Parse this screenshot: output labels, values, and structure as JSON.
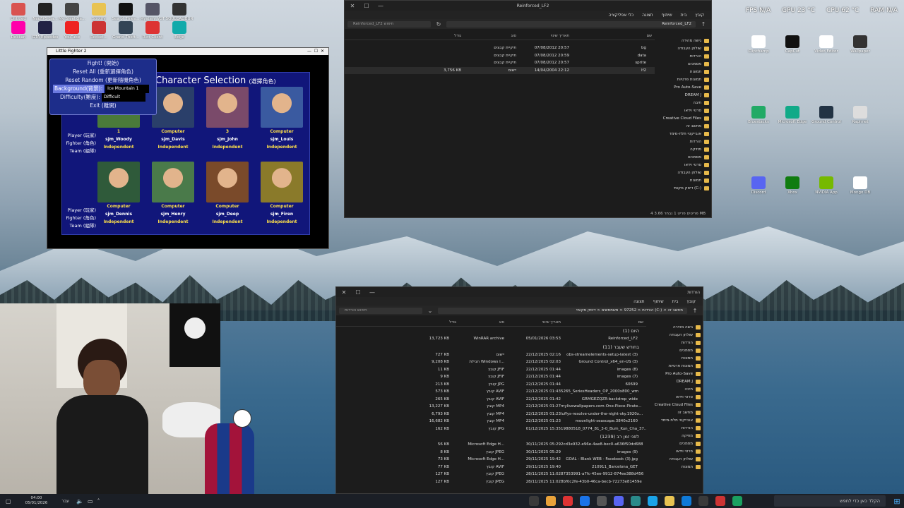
{
  "desktop_left_icons": [
    {
      "label": "Untitled",
      "color": "#d9534f"
    },
    {
      "label": "NeoFPS Ga...",
      "color": "#222"
    },
    {
      "label": "My Steel Ga...",
      "color": "#444"
    },
    {
      "label": "Spotify",
      "color": "#e8c352"
    },
    {
      "label": "Sea of Thiev...",
      "color": "#111"
    },
    {
      "label": "Mystery VGT",
      "color": "#556"
    },
    {
      "label": "SOULCALIBUR",
      "color": "#333"
    },
    {
      "label": "Dokkan",
      "color": "#f0a"
    },
    {
      "label": "GTA Episodes",
      "color": "#224"
    },
    {
      "label": "YouTube",
      "color": "#e22"
    },
    {
      "label": "Rocket...",
      "color": "#c33"
    },
    {
      "label": "Grand Theft...",
      "color": "#345"
    },
    {
      "label": "Riot Client",
      "color": "#d33"
    },
    {
      "label": "Edge",
      "color": "#1aa"
    }
  ],
  "desktop_right_icons": [
    {
      "label": "Clipchamp",
      "color": "#fff"
    },
    {
      "label": "CapCut",
      "color": "#111"
    },
    {
      "label": "Video Editor",
      "color": "#fff"
    },
    {
      "label": "Wallpaper",
      "color": "#333"
    },
    {
      "label": "Bluestacks",
      "color": "#2a6"
    },
    {
      "label": "Microsoft Edge",
      "color": "#1a8"
    },
    {
      "label": "Ground Control",
      "color": "#234"
    },
    {
      "label": "Raphnet",
      "color": "#ddd"
    },
    {
      "label": "Discord",
      "color": "#5865f2"
    },
    {
      "label": "Xbox",
      "color": "#107c10"
    },
    {
      "label": "NVIDIA App",
      "color": "#76b900"
    },
    {
      "label": "Mongo DB",
      "color": "#fff"
    }
  ],
  "lf2": {
    "title": "Little Fighter 2",
    "panel_title": "Character Selection",
    "panel_title_zh": "(選擇角色)",
    "menu": {
      "fight": "Fight! (開始)",
      "reset_all": "Reset All (重新選擇角色)",
      "reset_random": "Reset Random (更新隨機角色)",
      "background_label": "Background(背景):",
      "background_value": "Ice Mountain 1",
      "difficulty_label": "Difficulty(難度):",
      "difficulty_value": "Difficult",
      "exit": "Exit (離開)"
    },
    "row_labels": {
      "player": "Player (玩家)",
      "fighter": "Fighter (角色)",
      "team": "Team (組隊)"
    },
    "top_cards": [
      {
        "player": "1",
        "fighter": "sjm_Woody",
        "team": "Independent",
        "color": "#4a7a3a"
      },
      {
        "player": "Computer",
        "fighter": "sjm_Davis",
        "team": "Independent",
        "color": "#2a3f6a"
      },
      {
        "player": "3",
        "fighter": "sjm_John",
        "team": "Independent",
        "color": "#7a4a6a"
      },
      {
        "player": "Computer",
        "fighter": "sjm_Louis",
        "team": "Independent",
        "color": "#3a5aa0"
      }
    ],
    "bottom_cards": [
      {
        "player": "Computer",
        "fighter": "sjm_Dennis",
        "team": "Independent",
        "color": "#2f5a3a"
      },
      {
        "player": "Computer",
        "fighter": "sjm_Henry",
        "team": "Independent",
        "color": "#4a7a4a"
      },
      {
        "player": "Computer",
        "fighter": "sjm_Deep",
        "team": "Independent",
        "color": "#7a4a2a"
      },
      {
        "player": "Computer",
        "fighter": "sjm_Firen",
        "team": "Independent",
        "color": "#8a7a2a"
      }
    ]
  },
  "explorer_top": {
    "tab": "Reinforced_LF2",
    "ribbon": [
      "קובץ",
      "בית",
      "שיתוף",
      "תצוגה",
      "כלי אפליקציה"
    ],
    "path": "Reinforced_LF2",
    "search_placeholder": "Reinforced_LF2 חיפוש",
    "columns": {
      "name": "שם",
      "date": "תאריך שינוי",
      "type": "סוג",
      "size": "גודל"
    },
    "rows": [
      {
        "name": "bg",
        "date": "07/08/2012 20:57",
        "type": "תיקיית קבצים",
        "size": ""
      },
      {
        "name": "data",
        "date": "07/08/2012 20:59",
        "type": "תיקיית קבצים",
        "size": ""
      },
      {
        "name": "sprite",
        "date": "07/08/2012 20:57",
        "type": "תיקיית קבצים",
        "size": ""
      },
      {
        "name": "lf2",
        "date": "14/04/2004 22:12",
        "type": "יישום",
        "size": "3,756 KB"
      }
    ],
    "nav": [
      "גישה מהירה",
      "שולחן העבודה",
      "הורדות",
      "מסמכים",
      "תמונות",
      "תמונות פרטיות",
      "Pro Auto-Save",
      "DREAM J",
      "תיבה",
      "סרטי וידאו",
      "Creative Cloud Files",
      "מחשב זה",
      "אובייקטי תלת-מימד",
      "הורדות",
      "מוזיקה",
      "מסמכים",
      "סרטי וידאו",
      "שולחן העבודה",
      "תמונות",
      "דיסק מקומי (C:)"
    ],
    "status": "4 פריטים  פריט 1 נבחר  3.66 MB"
  },
  "explorer_bottom": {
    "tab": "הורדות",
    "ribbon": [
      "קובץ",
      "בית",
      "שיתוף",
      "תצוגה"
    ],
    "path": "הורדות < 97252 < משתמשים < דיסק מקומי (C:) < מחשב זה",
    "search_placeholder": "חיפוש הורדות",
    "columns": {
      "name": "שם",
      "date": "תאריך שינוי",
      "type": "סוג",
      "size": "גודל"
    },
    "groups": [
      {
        "title": "היום (1)",
        "rows": [
          {
            "name": "Reinforced_LF2",
            "date": "05/01/2026 03:53",
            "type": "WinRAR archive",
            "size": "13,723 KB"
          }
        ]
      },
      {
        "title": "בחודש שעבר (11)",
        "rows": [
          {
            "name": "obs-streamelements-setup-latest (3)",
            "date": "22/12/2025 02:16",
            "type": "יישום",
            "size": "727 KB"
          },
          {
            "name": "Ground Control_x64_en-US (3)",
            "date": "22/12/2025 02:03",
            "type": "חבילת Windows I...",
            "size": "9,208 KB"
          },
          {
            "name": "images (8)",
            "date": "22/12/2025 01:44",
            "type": "קובץ JFIF",
            "size": "11 KB"
          },
          {
            "name": "images (7)",
            "date": "22/12/2025 01:44",
            "type": "קובץ JFIF",
            "size": "9 KB"
          },
          {
            "name": "60699",
            "date": "22/12/2025 01:44",
            "type": "קובץ JPG",
            "size": "213 KB"
          },
          {
            "name": "5265_SeriesHeaders_OP_2000x800_wm",
            "date": "22/12/2025 01:43",
            "type": "קובץ AVIF",
            "size": "573 KB"
          },
          {
            "name": "GRMGEZQZR-backdrop_wide",
            "date": "22/12/2025 01:42",
            "type": "קובץ AVIF",
            "size": "265 KB"
          },
          {
            "name": "mylivewallpapers.com-One-Piece-Pirate...",
            "date": "22/12/2025 01:27",
            "type": "קובץ MP4",
            "size": "13,227 KB"
          },
          {
            "name": "luffys-resolve-under-the-night-sky.1920x...",
            "date": "22/12/2025 01:23",
            "type": "קובץ MP4",
            "size": "6,793 KB"
          },
          {
            "name": "moonlight-seascape.3840x2160",
            "date": "22/12/2025 01:23",
            "type": "קובץ MP4",
            "size": "16,682 KB"
          },
          {
            "name": "19880518_0774_81_3-0_Bum_Kun_Cha_37...",
            "date": "01/12/2025 15:35",
            "type": "קובץ JPG",
            "size": "162 KB"
          }
        ]
      },
      {
        "title": "לפני זמן רב (1239)",
        "rows": [
          {
            "name": "2cd3e932-e96e-4ae8-bec0-a636f50dd688",
            "date": "30/11/2025 05:29",
            "type": "Microsoft Edge H...",
            "size": "56 KB"
          },
          {
            "name": "images (9)",
            "date": "30/11/2025 05:29",
            "type": "קובץ JPEG",
            "size": "8 KB"
          },
          {
            "name": "GOAL - Blank WEB - Facebook (3).jpg",
            "date": "29/11/2025 19:42",
            "type": "Microsoft Edge H...",
            "size": "73 KB"
          },
          {
            "name": "210911_Barcelona_GET",
            "date": "29/11/2025 19:40",
            "type": "קובץ AVIF",
            "size": "77 KB"
          },
          {
            "name": "87353991-a7fc-45ee-9912-874ee388d456",
            "date": "28/11/2025 11:02",
            "type": "קובץ JPEG",
            "size": "127 KB"
          },
          {
            "name": "8bf0c2fe-43b0-46ca-becb-72273e81459e",
            "date": "28/11/2025 11:02",
            "type": "קובץ JPEG",
            "size": "127 KB"
          }
        ]
      }
    ],
    "nav": [
      "גישה מהירה",
      "שולחן העבודה",
      "הורדות",
      "מסמכים",
      "תמונות",
      "תמונות פרטיות",
      "Pro Auto-Save",
      "DREAM J",
      "תיבה",
      "סרטי וידאו",
      "Creative Cloud Files",
      "מחשב זה",
      "אובייקטי תלת-מימד",
      "הורדות",
      "מוזיקה",
      "מסמכים",
      "סרטי וידאו",
      "שולחן העבודה",
      "תמונות"
    ]
  },
  "overlay": {
    "fps": "FPS N/A",
    "gpu": "GPU 23 °C",
    "cpu": "CPU 62 °C",
    "ram": "RAM N/A"
  },
  "taskbar": {
    "search_placeholder": "הקלד כאן כדי לחפש",
    "time": "04:00",
    "date": "05/01/2026",
    "lang": "עבר"
  }
}
